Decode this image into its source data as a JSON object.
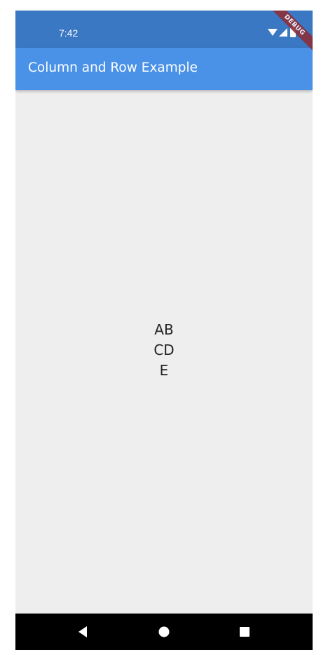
{
  "status_bar": {
    "time": "7:42",
    "icons": [
      "wifi-icon",
      "signal-icon",
      "battery-icon"
    ],
    "color": "#3a78c4"
  },
  "app_bar": {
    "title": "Column and Row Example",
    "color": "#4a92e8"
  },
  "content": {
    "rows": [
      {
        "cells": [
          "A",
          "B"
        ]
      },
      {
        "cells": [
          "C",
          "D"
        ]
      },
      {
        "cells": [
          "E"
        ]
      }
    ],
    "background": "#eeeeee"
  },
  "debug_banner": {
    "label": "DEBUG"
  },
  "nav_bar": {
    "buttons": [
      "back-icon",
      "home-icon",
      "recents-icon"
    ]
  }
}
